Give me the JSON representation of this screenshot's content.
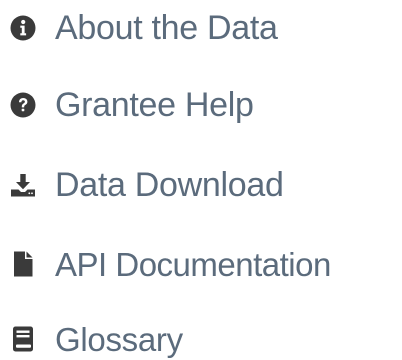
{
  "colors": {
    "icon": "#3a3a3a",
    "text": "#5b6b7c"
  },
  "menu": {
    "items": [
      {
        "id": "about",
        "label": "About the Data",
        "icon": "info-circle-icon"
      },
      {
        "id": "help",
        "label": "Grantee Help",
        "icon": "question-circle-icon"
      },
      {
        "id": "download",
        "label": "Data Download",
        "icon": "download-icon"
      },
      {
        "id": "api",
        "label": "API Documentation",
        "icon": "file-icon"
      },
      {
        "id": "glossary",
        "label": "Glossary",
        "icon": "book-icon"
      }
    ]
  }
}
